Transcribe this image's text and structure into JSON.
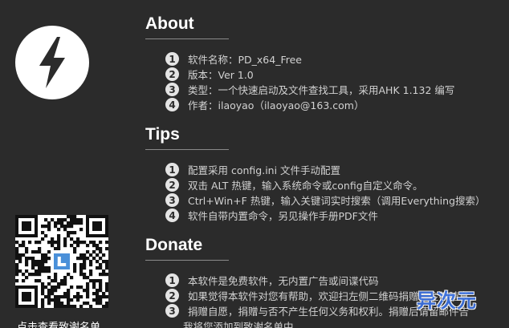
{
  "about": {
    "title": "About",
    "items": [
      {
        "num": "1",
        "text": "软件名称：PD_x64_Free"
      },
      {
        "num": "2",
        "text": "版本：Ver 1.0"
      },
      {
        "num": "3",
        "text": "类型：一个快速启动及文件查找工具，采用AHK 1.132 编写"
      },
      {
        "num": "4",
        "text": "作者：ilaoyao（ilaoyao@163.com）"
      }
    ]
  },
  "tips": {
    "title": "Tips",
    "items": [
      {
        "num": "1",
        "text": "配置采用 config.ini 文件手动配置"
      },
      {
        "num": "2",
        "text": "双击 ALT 热键，输入系统命令或config自定义命令。"
      },
      {
        "num": "3",
        "text": "Ctrl+Win+F 热键，输入关键词实时搜索（调用Everything搜索）"
      },
      {
        "num": "4",
        "text": "软件自带内置命令，另见操作手册PDF文件"
      }
    ]
  },
  "donate": {
    "title": "Donate",
    "items": [
      {
        "num": "1",
        "text": "本软件是免费软件，无内置广告或间谍代码"
      },
      {
        "num": "2",
        "text": "如果觉得本软件对您有帮助，欢迎扫左侧二维码捐赠，金额随意"
      },
      {
        "num": "3",
        "text": "捐赠自愿，捐赠与否不产生任何义务和权利。捐赠后请留邮件告"
      }
    ],
    "continuation": "我将您添加到致谢名单中"
  },
  "qr_caption": "点击查看致谢名单",
  "watermark": "异次元",
  "icons": {
    "logo": "lightning-bolt-logo",
    "qr": "qr-code"
  },
  "colors": {
    "background": "#2b2b2b",
    "text": "#d2d2d2",
    "title": "#ffffff",
    "watermark": "#3b73e6"
  }
}
